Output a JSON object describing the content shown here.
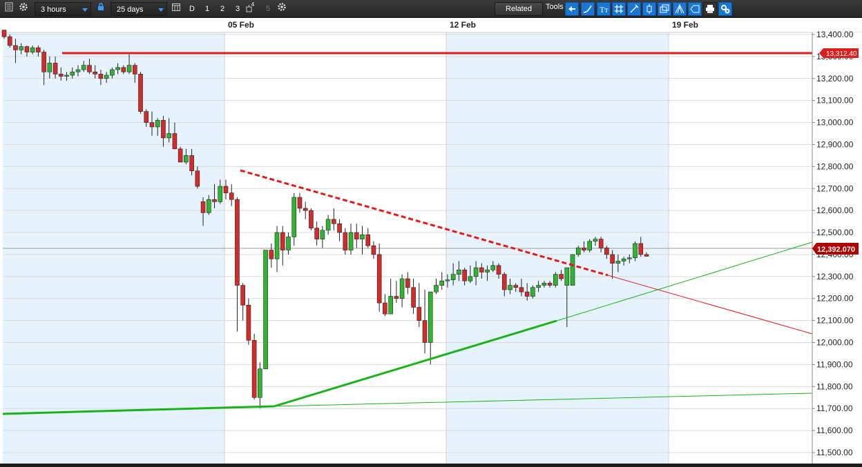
{
  "toolbar": {
    "timeframe": "3 hours",
    "range": "25 days",
    "period_buttons": [
      "D",
      "1",
      "2",
      "3",
      "4",
      "5"
    ],
    "related_label": "Related",
    "tools_label": "Tools",
    "icons": [
      "list-icon",
      "gear-icon",
      "lock-icon",
      "calendar-icon",
      "chart-type-icon",
      "settings-icon",
      "back-arrow-icon",
      "curve-icon",
      "text-icon",
      "hash-icon",
      "pencil-icon",
      "candle-icon",
      "windows-icon",
      "fork-icon",
      "tag-icon",
      "print-icon",
      "config-icon"
    ]
  },
  "chart": {
    "date_labels": [
      "05 Feb",
      "12 Feb",
      "19 Feb"
    ],
    "price_labels": [
      "13,400.00",
      "13,300.00",
      "13,200.00",
      "13,100.00",
      "13,000.00",
      "12,900.00",
      "12,800.00",
      "12,700.00",
      "12,600.00",
      "12,500.00",
      "12,400.00",
      "12,300.00",
      "12,200.00",
      "12,100.00",
      "12,000.00",
      "11,900.00",
      "11,800.00",
      "11,700.00",
      "11,600.00",
      "11,500.00"
    ],
    "resistance_label": "13,312.40",
    "current_price_label": "12,392.070",
    "colors": {
      "up": "#2fb52f",
      "down": "#d42a2a",
      "band": "#e6f3fc",
      "grid": "#d9d9d9",
      "resistance": "#e31a1a",
      "support": "#19b219"
    }
  },
  "chart_data": {
    "type": "candlestick",
    "y_range": [
      11480,
      13440
    ],
    "levels": {
      "resistance": 13312.4,
      "current": 12392.07
    },
    "candles": [
      [
        13420,
        13420,
        13380,
        13390
      ],
      [
        13390,
        13400,
        13340,
        13350
      ],
      [
        13350,
        13380,
        13270,
        13330
      ],
      [
        13330,
        13360,
        13310,
        13345
      ],
      [
        13345,
        13350,
        13300,
        13320
      ],
      [
        13320,
        13350,
        13310,
        13340
      ],
      [
        13340,
        13350,
        13300,
        13320
      ],
      [
        13320,
        13330,
        13170,
        13230
      ],
      [
        13230,
        13300,
        13200,
        13270
      ],
      [
        13270,
        13300,
        13200,
        13220
      ],
      [
        13220,
        13250,
        13190,
        13210
      ],
      [
        13210,
        13230,
        13190,
        13215
      ],
      [
        13215,
        13250,
        13200,
        13230
      ],
      [
        13230,
        13260,
        13210,
        13240
      ],
      [
        13240,
        13280,
        13230,
        13260
      ],
      [
        13260,
        13290,
        13220,
        13230
      ],
      [
        13230,
        13260,
        13200,
        13220
      ],
      [
        13220,
        13240,
        13170,
        13200
      ],
      [
        13200,
        13230,
        13180,
        13215
      ],
      [
        13215,
        13250,
        13200,
        13240
      ],
      [
        13240,
        13270,
        13220,
        13250
      ],
      [
        13250,
        13260,
        13220,
        13230
      ],
      [
        13230,
        13310,
        13220,
        13260
      ],
      [
        13260,
        13270,
        13180,
        13220
      ],
      [
        13220,
        13230,
        13040,
        13050
      ],
      [
        13050,
        13060,
        12980,
        13000
      ],
      [
        13000,
        13050,
        12940,
        12980
      ],
      [
        12980,
        13020,
        12940,
        13010
      ],
      [
        13010,
        13030,
        12890,
        12930
      ],
      [
        12930,
        13020,
        12910,
        12950
      ],
      [
        12950,
        13000,
        12880,
        12880
      ],
      [
        12880,
        12890,
        12820,
        12820
      ],
      [
        12820,
        12880,
        12810,
        12850
      ],
      [
        12850,
        12880,
        12760,
        12780
      ],
      [
        12780,
        12800,
        12700,
        12710
      ],
      [
        12640,
        12660,
        12530,
        12590
      ],
      [
        12590,
        12670,
        12580,
        12650
      ],
      [
        12650,
        12720,
        12610,
        12640
      ],
      [
        12640,
        12740,
        12630,
        12710
      ],
      [
        12710,
        12740,
        12650,
        12680
      ],
      [
        12680,
        12720,
        12620,
        12650
      ],
      [
        12650,
        12660,
        12050,
        12260
      ],
      [
        12260,
        12270,
        12100,
        12170
      ],
      [
        12170,
        12200,
        11990,
        12010
      ],
      [
        12010,
        12040,
        11740,
        11750
      ],
      [
        11750,
        11910,
        11700,
        11880
      ],
      [
        11880,
        12410,
        11880,
        12420
      ],
      [
        12420,
        12450,
        12340,
        12380
      ],
      [
        12380,
        12530,
        12320,
        12500
      ],
      [
        12500,
        12530,
        12350,
        12420
      ],
      [
        12420,
        12500,
        12400,
        12480
      ],
      [
        12480,
        12680,
        12440,
        12660
      ],
      [
        12660,
        12680,
        12590,
        12610
      ],
      [
        12610,
        12640,
        12560,
        12600
      ],
      [
        12600,
        12610,
        12510,
        12520
      ],
      [
        12520,
        12550,
        12440,
        12470
      ],
      [
        12470,
        12530,
        12430,
        12510
      ],
      [
        12510,
        12580,
        12490,
        12560
      ],
      [
        12560,
        12610,
        12510,
        12540
      ],
      [
        12540,
        12560,
        12460,
        12500
      ],
      [
        12500,
        12520,
        12400,
        12420
      ],
      [
        12420,
        12540,
        12400,
        12500
      ],
      [
        12500,
        12540,
        12430,
        12470
      ],
      [
        12470,
        12530,
        12400,
        12490
      ],
      [
        12490,
        12520,
        12430,
        12440
      ],
      [
        12440,
        12460,
        12380,
        12400
      ],
      [
        12400,
        12450,
        12140,
        12180
      ],
      [
        12180,
        12220,
        12120,
        12130
      ],
      [
        12130,
        12290,
        12130,
        12210
      ],
      [
        12210,
        12280,
        12180,
        12200
      ],
      [
        12200,
        12310,
        12160,
        12290
      ],
      [
        12290,
        12320,
        12220,
        12250
      ],
      [
        12250,
        12290,
        12130,
        12160
      ],
      [
        12160,
        12270,
        12070,
        12100
      ],
      [
        12100,
        12240,
        11950,
        12000
      ],
      [
        12000,
        12230,
        11900,
        12230
      ],
      [
        12230,
        12290,
        12220,
        12260
      ],
      [
        12260,
        12320,
        12240,
        12280
      ],
      [
        12280,
        12310,
        12250,
        12285
      ],
      [
        12285,
        12360,
        12260,
        12310
      ],
      [
        12310,
        12370,
        12280,
        12330
      ],
      [
        12330,
        12340,
        12260,
        12280
      ],
      [
        12280,
        12350,
        12270,
        12300
      ],
      [
        12300,
        12370,
        12260,
        12340
      ],
      [
        12340,
        12360,
        12290,
        12320
      ],
      [
        12320,
        12350,
        12280,
        12330
      ],
      [
        12330,
        12370,
        12320,
        12350
      ],
      [
        12350,
        12360,
        12290,
        12310
      ],
      [
        12310,
        12320,
        12210,
        12240
      ],
      [
        12240,
        12290,
        12220,
        12260
      ],
      [
        12260,
        12270,
        12230,
        12250
      ],
      [
        12250,
        12290,
        12210,
        12230
      ],
      [
        12230,
        12270,
        12190,
        12210
      ],
      [
        12210,
        12260,
        12200,
        12250
      ],
      [
        12250,
        12280,
        12230,
        12260
      ],
      [
        12260,
        12280,
        12250,
        12270
      ],
      [
        12270,
        12280,
        12250,
        12260
      ],
      [
        12260,
        12320,
        12250,
        12310
      ],
      [
        12310,
        12330,
        12280,
        12290
      ],
      [
        12260,
        12280,
        12070,
        12340
      ],
      [
        12260,
        12400,
        12260,
        12400
      ],
      [
        12400,
        12440,
        12390,
        12430
      ],
      [
        12430,
        12460,
        12410,
        12420
      ],
      [
        12420,
        12470,
        12410,
        12460
      ],
      [
        12460,
        12480,
        12440,
        12470
      ],
      [
        12470,
        12480,
        12410,
        12430
      ],
      [
        12430,
        12440,
        12380,
        12400
      ],
      [
        12400,
        12420,
        12290,
        12360
      ],
      [
        12360,
        12400,
        12320,
        12370
      ],
      [
        12370,
        12390,
        12350,
        12380
      ],
      [
        12380,
        12400,
        12360,
        12385
      ],
      [
        12385,
        12460,
        12370,
        12450
      ],
      [
        12450,
        12480,
        12390,
        12400
      ],
      [
        12400,
        12410,
        12390,
        12392
      ]
    ],
    "candle_width": 6
  }
}
